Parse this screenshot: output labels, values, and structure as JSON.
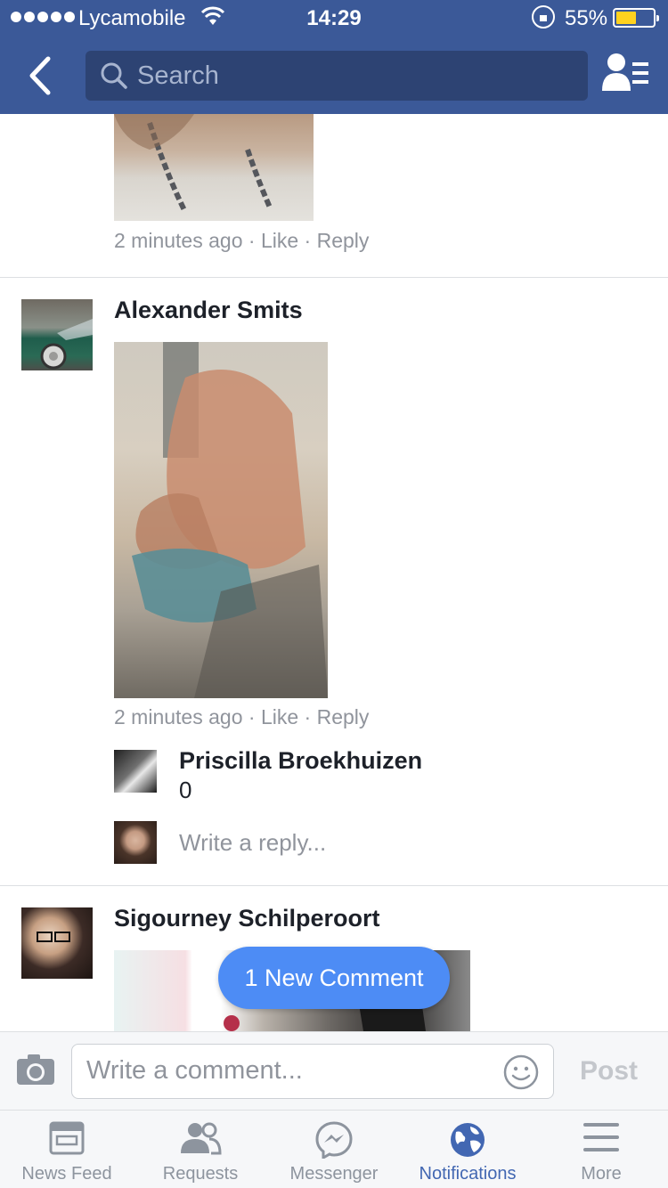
{
  "status_bar": {
    "carrier": "Lycamobile",
    "time": "14:29",
    "battery_percent": "55%",
    "battery_level": 0.55
  },
  "nav": {
    "search_placeholder": "Search"
  },
  "comments": [
    {
      "time": "2 minutes ago",
      "like": "Like",
      "reply": "Reply"
    },
    {
      "author": "Alexander Smits",
      "time": "2 minutes ago",
      "like": "Like",
      "reply": "Reply",
      "replies": [
        {
          "author": "Priscilla Broekhuizen",
          "text": "0"
        }
      ],
      "write_reply_placeholder": "Write a reply..."
    },
    {
      "author": "Sigourney Schilperoort"
    }
  ],
  "new_comment_pill": "1 New Comment",
  "composer": {
    "placeholder": "Write a comment...",
    "post_label": "Post"
  },
  "tabs": [
    {
      "label": "News Feed",
      "icon": "news-feed-icon"
    },
    {
      "label": "Requests",
      "icon": "friend-requests-icon"
    },
    {
      "label": "Messenger",
      "icon": "messenger-icon"
    },
    {
      "label": "Notifications",
      "icon": "globe-icon",
      "active": true
    },
    {
      "label": "More",
      "icon": "menu-icon"
    }
  ],
  "colors": {
    "brand": "#3b5998",
    "active_tab": "#4267b2",
    "pill": "#4d8cf5"
  }
}
